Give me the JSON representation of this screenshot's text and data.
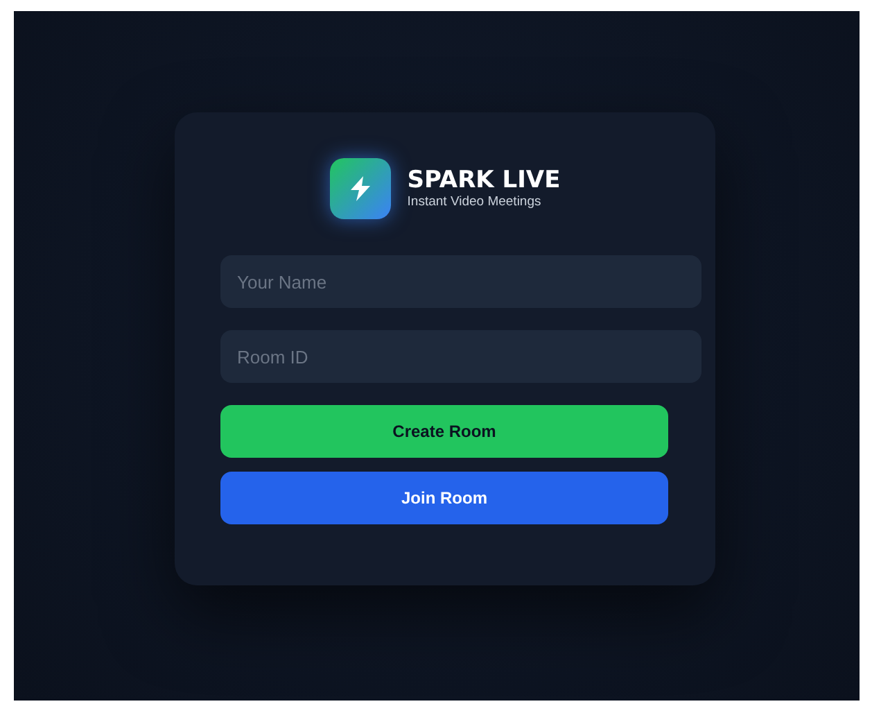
{
  "brand": {
    "title": "SPARK LIVE",
    "subtitle": "Instant Video Meetings"
  },
  "fields": [
    {
      "placeholder": "Your Name"
    },
    {
      "placeholder": "Room ID"
    }
  ],
  "buttons": [
    {
      "label": "Create Room",
      "kind": "success"
    },
    {
      "label": "Join Room",
      "kind": "primary"
    }
  ]
}
